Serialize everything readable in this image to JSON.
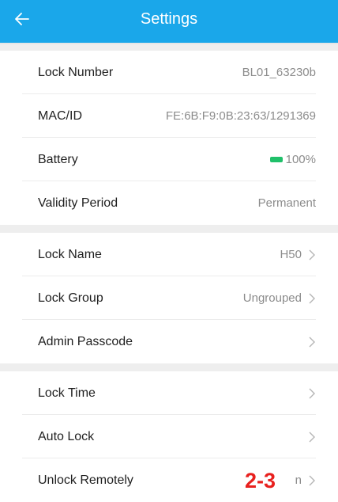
{
  "header": {
    "title": "Settings",
    "back_icon": "arrow-left-icon"
  },
  "section1": [
    {
      "label": "Lock Number",
      "value": "BL01_63230b"
    },
    {
      "label": "MAC/ID",
      "value": "FE:6B:F9:0B:23:63/1291369"
    },
    {
      "label": "Battery",
      "value": "100%",
      "indicator_color": "#20c06a"
    },
    {
      "label": "Validity Period",
      "value": "Permanent"
    }
  ],
  "section2": [
    {
      "label": "Lock Name",
      "value": "H50"
    },
    {
      "label": "Lock Group",
      "value": "Ungrouped"
    },
    {
      "label": "Admin Passcode",
      "value": ""
    }
  ],
  "section3": [
    {
      "label": "Lock Time",
      "value": ""
    },
    {
      "label": "Auto Lock",
      "value": ""
    },
    {
      "label": "Unlock Remotely",
      "value": "n"
    }
  ],
  "overlay_label": "2-3",
  "colors": {
    "header_bg": "#1aa7ea",
    "overlay_text": "#e8201e"
  }
}
